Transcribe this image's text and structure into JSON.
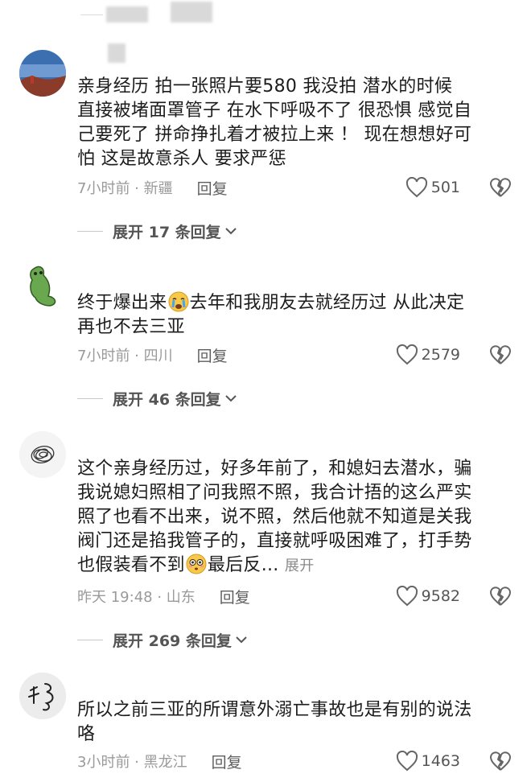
{
  "comments": [
    {
      "lines": [
        "亲身经历  拍一张照片要580  我没拍  潜水的时候",
        "直接被堵面罩管子  在水下呼吸不了  很恐惧 感觉自",
        "己要死了  拼命挣扎着才被拉上来  ！ 现在想想好可",
        "怕  这是故意杀人 要求严惩"
      ],
      "time": "7小时前 · 新疆",
      "reply": "回复",
      "likes": "501",
      "more": "展开 17 条回复"
    },
    {
      "line1_a": "终于爆出来",
      "line1_b": "去年和我朋友去就经历过 从此决定",
      "line2": "再也不去三亚",
      "time": "7小时前 · 四川",
      "reply": "回复",
      "likes": "2579",
      "more": "展开 46 条回复"
    },
    {
      "lines": [
        "这个亲身经历过，好多年前了，和媳妇去潜水，骗",
        "我说媳妇照相了问我照不照，我合计捂的这么严实",
        "照了也看不出来，说不照，然后他就不知道是关我",
        "阀门还是掐我管子的，直接就呼吸困难了，打手势"
      ],
      "last_a": "也假装看不到",
      "last_b": "最后反...",
      "expand": "展开",
      "time": "昨天 19:48 · 山东",
      "reply": "回复",
      "likes": "9582",
      "more": "展开 269 条回复"
    },
    {
      "lines": [
        "所以之前三亚的所谓意外溺亡事故也是有别的说法",
        "咯"
      ],
      "time": "3小时前 · 黑龙江",
      "reply": "回复",
      "likes": "1463"
    }
  ],
  "icons": {
    "like": "heart-outline-icon",
    "dislike": "broken-heart-icon",
    "chevron": "chevron-down-icon",
    "emoji1": "crying-face-icon",
    "emoji2": "flushed-face-icon"
  }
}
